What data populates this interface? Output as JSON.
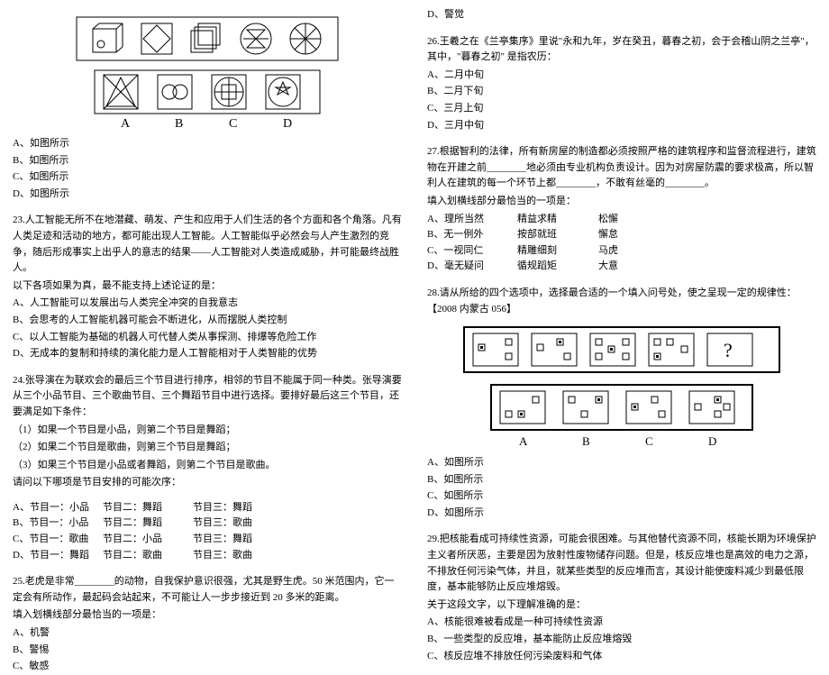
{
  "left": {
    "q22": {
      "figure_labels": [
        "A",
        "B",
        "C",
        "D"
      ],
      "opts": [
        "A、如图所示",
        "B、如图所示",
        "C、如图所示",
        "D、如图所示"
      ]
    },
    "q23": {
      "num": "23.",
      "body": "人工智能无所不在地潜藏、萌发、产生和应用于人们生活的各个方面和各个角落。凡有人类足迹和活动的地方，都可能出现人工智能。人工智能似乎必然会与人产生激烈的竞争，随后形成事实上出乎人的意志的结果——人工智能对人类造成威胁，并可能最终战胜人。",
      "prompt": "以下各项如果为真，最不能支持上述论证的是：",
      "opts": [
        "A、人工智能可以发展出与人类完全冲突的自我意志",
        "B、会思考的人工智能机器可能会不断进化，从而摆脱人类控制",
        "C、以人工智能为基础的机器人可代替人类从事探测、排爆等危险工作",
        "D、无成本的复制和持续的演化能力是人工智能相对于人类智能的优势"
      ]
    },
    "q24": {
      "num": "24.",
      "body": "张导演在为联欢会的最后三个节目进行排序，相邻的节目不能属于同一种类。张导演要从三个小品节目、三个歌曲节目、三个舞蹈节目中进行选择。要排好最后这三个节目，还要满足如下条件：",
      "cond1": "（1）如果一个节目是小品，则第二个节目是舞蹈；",
      "cond2": "（2）如果二个节目是歌曲，则第三个节目是舞蹈；",
      "cond3": "（3）如果三个节目是小品或者舞蹈，则第二个节目是歌曲。",
      "ask": "请问以下哪项是节目安排的可能次序：",
      "rows": [
        [
          "A、节目一：小品",
          "节目二：舞蹈",
          "节目三：舞蹈"
        ],
        [
          "B、节目一：小品",
          "节目二：舞蹈",
          "节目三：歌曲"
        ],
        [
          "C、节目一：歌曲",
          "节目二：小品",
          "节目三：舞蹈"
        ],
        [
          "D、节目一：舞蹈",
          "节目二：歌曲",
          "节目三：歌曲"
        ]
      ]
    },
    "q25": {
      "num": "25.",
      "body": "老虎是非常________的动物，自我保护意识很强，尤其是野生虎。50 米范围内，它一定会有所动作，最起码会站起来，不可能让人一步步接近到 20 多米的距离。",
      "prompt": "填入划横线部分最恰当的一项是：",
      "opts": [
        "A、机警",
        "B、警惕",
        "C、敏感"
      ]
    }
  },
  "right": {
    "q25d": "D、警觉",
    "q26": {
      "num": "26.",
      "body": "王羲之在《兰亭集序》里说\"永和九年，岁在癸丑，暮春之初，会于会稽山阴之兰亭\"，其中，\"暮春之初\" 是指农历：",
      "opts": [
        "A、二月中旬",
        "B、二月下旬",
        "C、三月上旬",
        "D、三月中旬"
      ]
    },
    "q27": {
      "num": "27.",
      "body": "根据智利的法律，所有新房屋的制造都必须按照严格的建筑程序和监督流程进行，建筑物在开建之前________地必须由专业机构负责设计。因为对房屋防震的要求极高，所以智利人在建筑的每一个环节上都________，不敢有丝毫的________。",
      "prompt": "填入划横线部分最恰当的一项是：",
      "rows": [
        [
          "A、理所当然",
          "精益求精",
          "松懈"
        ],
        [
          "B、无一例外",
          "按部就班",
          "懈怠"
        ],
        [
          "C、一视同仁",
          "精雕细刻",
          "马虎"
        ],
        [
          "D、毫无疑问",
          "循规蹈矩",
          "大意"
        ]
      ]
    },
    "q28": {
      "num": "28.",
      "body": "请从所给的四个选项中，选择最合适的一个填入问号处，使之呈现一定的规律性：【2008 内蒙古 056】",
      "labels": [
        "A",
        "B",
        "C",
        "D"
      ],
      "opts": [
        "A、如图所示",
        "B、如图所示",
        "C、如图所示",
        "D、如图所示"
      ]
    },
    "q29": {
      "num": "29.",
      "body": "把核能看成可持续性资源，可能会很困难。与其他替代资源不同，核能长期为环境保护主义者所厌恶，主要是因为放射性废物储存问题。但是，核反应堆也是高效的电力之源，不排放任何污染气体，并且，就某些类型的反应堆而言，其设计能使废料减少到最低限度，基本能够防止反应堆熔毁。",
      "prompt": "关于这段文字，以下理解准确的是：",
      "opts": [
        "A、核能很难被看成是一种可持续性资源",
        "B、一些类型的反应堆，基本能防止反应堆熔毁",
        "C、核反应堆不排放任何污染废料和气体"
      ]
    }
  }
}
